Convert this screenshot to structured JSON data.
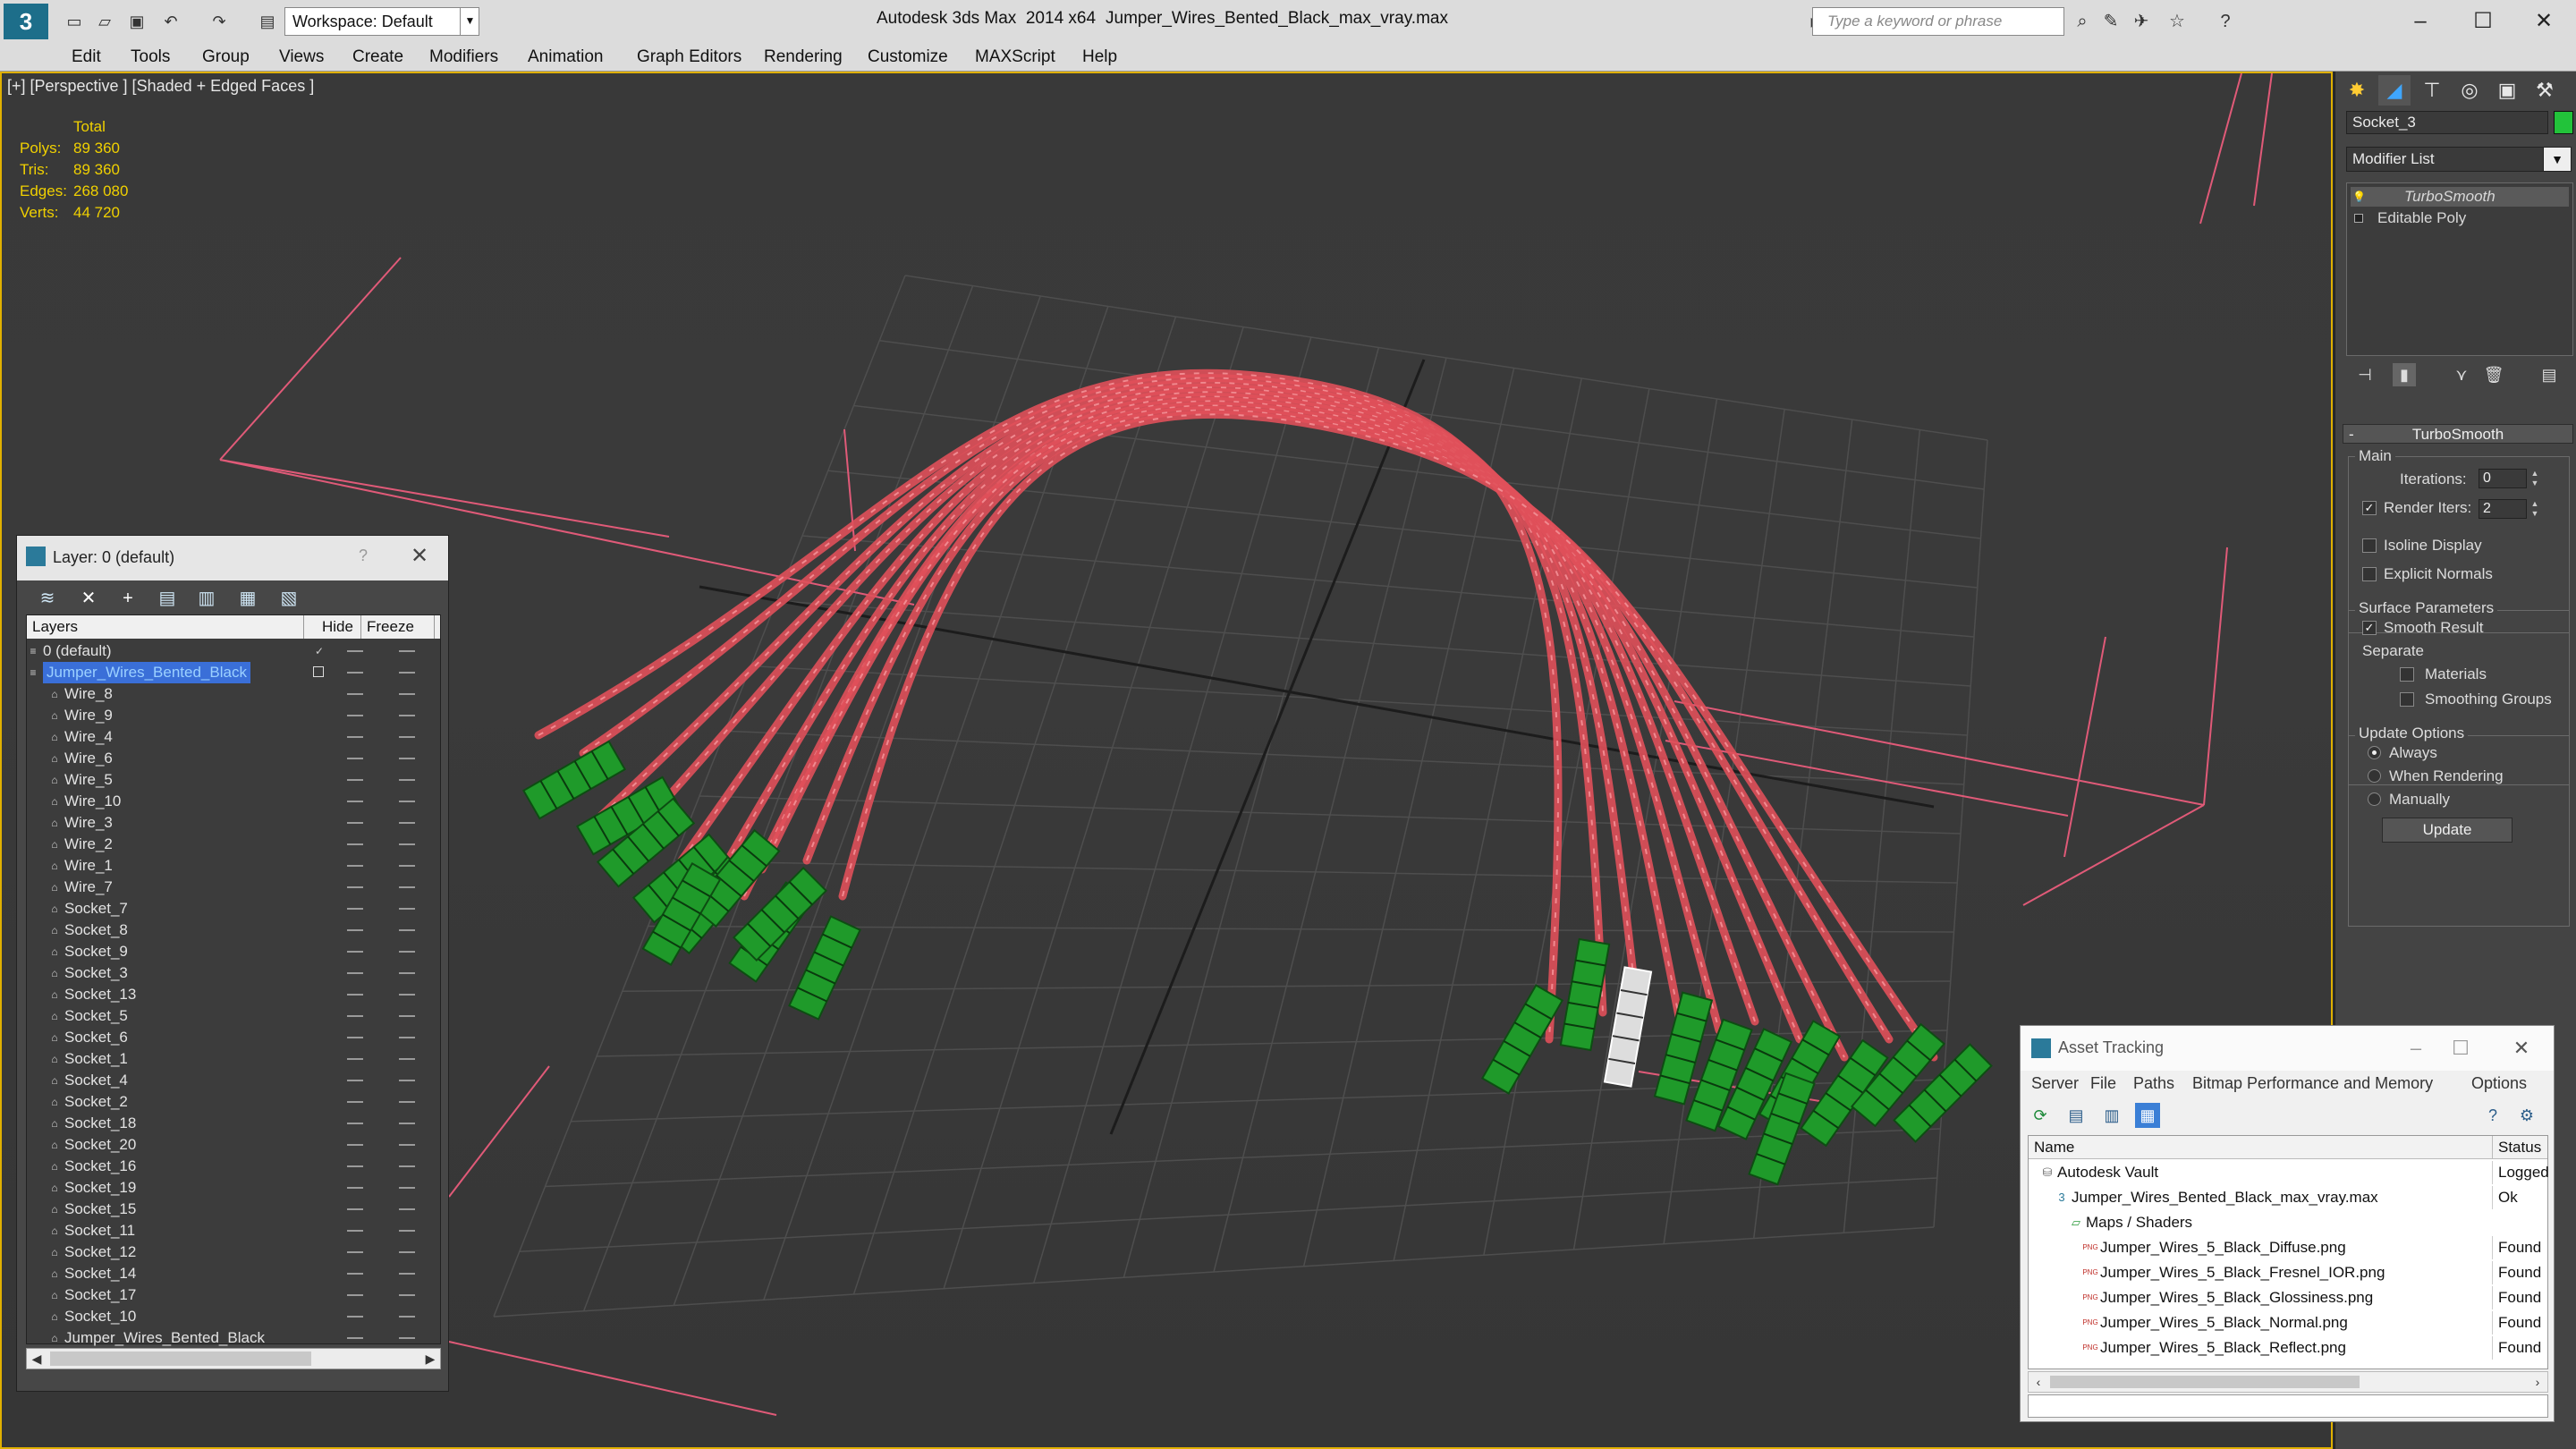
{
  "window": {
    "app_title": "Autodesk 3ds Max  2014 x64",
    "file_title": "Jumper_Wires_Bented_Black_max_vray.max",
    "workspace": "Workspace: Default",
    "search_placeholder": "Type a keyword or phrase"
  },
  "menu": [
    "Edit",
    "Tools",
    "Group",
    "Views",
    "Create",
    "Modifiers",
    "Animation",
    "Graph Editors",
    "Rendering",
    "Customize",
    "MAXScript",
    "Help"
  ],
  "viewport": {
    "label": "[+] [Perspective ] [Shaded + Edged Faces ]",
    "stats_header": "Total",
    "stats": [
      {
        "label": "Polys:",
        "value": "89 360"
      },
      {
        "label": "Tris:",
        "value": "89 360"
      },
      {
        "label": "Edges:",
        "value": "268 080"
      },
      {
        "label": "Verts:",
        "value": "44 720"
      }
    ],
    "colors": {
      "wire": "#e0505a",
      "socket": "#1f9a2a",
      "grid": "#4e4e4e"
    }
  },
  "layer_explorer": {
    "title": "Layer: 0 (default)",
    "help": "?",
    "columns": {
      "layers": "Layers",
      "hide": "Hide",
      "freeze": "Freeze"
    },
    "rows": [
      {
        "name": "0 (default)",
        "level": 1
      },
      {
        "name": "Jumper_Wires_Bented_Black",
        "level": 1,
        "selected": true
      },
      {
        "name": "Wire_8",
        "level": 2
      },
      {
        "name": "Wire_9",
        "level": 2
      },
      {
        "name": "Wire_4",
        "level": 2
      },
      {
        "name": "Wire_6",
        "level": 2
      },
      {
        "name": "Wire_5",
        "level": 2
      },
      {
        "name": "Wire_10",
        "level": 2
      },
      {
        "name": "Wire_3",
        "level": 2
      },
      {
        "name": "Wire_2",
        "level": 2
      },
      {
        "name": "Wire_1",
        "level": 2
      },
      {
        "name": "Wire_7",
        "level": 2
      },
      {
        "name": "Socket_7",
        "level": 2
      },
      {
        "name": "Socket_8",
        "level": 2
      },
      {
        "name": "Socket_9",
        "level": 2
      },
      {
        "name": "Socket_3",
        "level": 2
      },
      {
        "name": "Socket_13",
        "level": 2
      },
      {
        "name": "Socket_5",
        "level": 2
      },
      {
        "name": "Socket_6",
        "level": 2
      },
      {
        "name": "Socket_1",
        "level": 2
      },
      {
        "name": "Socket_4",
        "level": 2
      },
      {
        "name": "Socket_2",
        "level": 2
      },
      {
        "name": "Socket_18",
        "level": 2
      },
      {
        "name": "Socket_20",
        "level": 2
      },
      {
        "name": "Socket_16",
        "level": 2
      },
      {
        "name": "Socket_19",
        "level": 2
      },
      {
        "name": "Socket_15",
        "level": 2
      },
      {
        "name": "Socket_11",
        "level": 2
      },
      {
        "name": "Socket_12",
        "level": 2
      },
      {
        "name": "Socket_14",
        "level": 2
      },
      {
        "name": "Socket_17",
        "level": 2
      },
      {
        "name": "Socket_10",
        "level": 2
      },
      {
        "name": "Jumper_Wires_Bented_Black",
        "level": 2
      }
    ]
  },
  "command_panel": {
    "object_name": "Socket_3",
    "object_color": "#22c33a",
    "modifier_list": "Modifier List",
    "stack": [
      "TurboSmooth",
      "Editable Poly"
    ],
    "turbosmooth": {
      "title": "TurboSmooth",
      "main": "Main",
      "iterations_label": "Iterations:",
      "iterations": "0",
      "render_iters_label": "Render Iters:",
      "render_iters": "2",
      "isoline": "Isoline Display",
      "explicit_normals": "Explicit Normals",
      "surface_params": "Surface Parameters",
      "smooth_result": "Smooth Result",
      "separate": "Separate",
      "materials": "Materials",
      "smoothing_groups": "Smoothing Groups",
      "update_options": "Update Options",
      "always": "Always",
      "when_rendering": "When Rendering",
      "manually": "Manually",
      "update": "Update"
    }
  },
  "asset_tracking": {
    "title": "Asset Tracking",
    "menu": [
      "Server",
      "File",
      "Paths",
      "Bitmap Performance and Memory",
      "Options"
    ],
    "columns": {
      "name": "Name",
      "status": "Status"
    },
    "rows": [
      {
        "name": "Autodesk Vault",
        "status": "Logged",
        "level": 0,
        "icon": "vault-icon"
      },
      {
        "name": "Jumper_Wires_Bented_Black_max_vray.max",
        "status": "Ok",
        "level": 1,
        "icon": "max-file-icon"
      },
      {
        "name": "Maps / Shaders",
        "status": "",
        "level": 2,
        "icon": "maps-icon"
      },
      {
        "name": "Jumper_Wires_5_Black_Diffuse.png",
        "status": "Found",
        "level": 3,
        "icon": "png-icon"
      },
      {
        "name": "Jumper_Wires_5_Black_Fresnel_IOR.png",
        "status": "Found",
        "level": 3,
        "icon": "png-icon"
      },
      {
        "name": "Jumper_Wires_5_Black_Glossiness.png",
        "status": "Found",
        "level": 3,
        "icon": "png-icon"
      },
      {
        "name": "Jumper_Wires_5_Black_Normal.png",
        "status": "Found",
        "level": 3,
        "icon": "png-icon"
      },
      {
        "name": "Jumper_Wires_5_Black_Reflect.png",
        "status": "Found",
        "level": 3,
        "icon": "png-icon"
      }
    ]
  }
}
